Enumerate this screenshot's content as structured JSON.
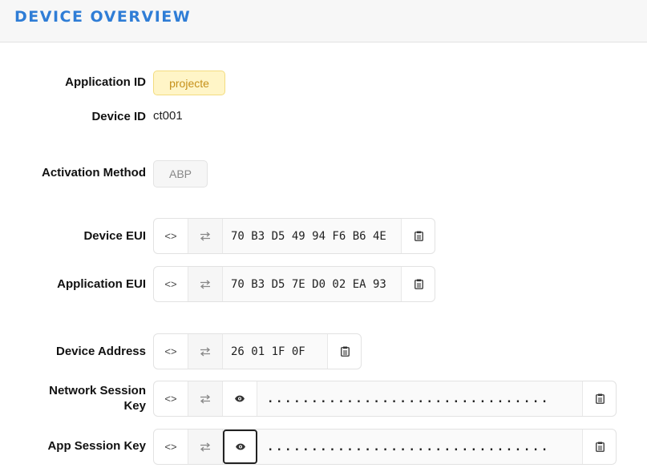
{
  "header": {
    "title": "DEVICE OVERVIEW"
  },
  "labels": {
    "application_id": "Application ID",
    "device_id": "Device ID",
    "activation_method": "Activation Method",
    "device_eui": "Device EUI",
    "application_eui": "Application EUI",
    "device_address": "Device Address",
    "network_session_key_line1": "Network Session",
    "network_session_key_line2": "Key",
    "app_session_key": "App Session Key"
  },
  "values": {
    "application_id": "projecte",
    "device_id": "ct001",
    "activation_method": "ABP",
    "device_eui": "70 B3 D5 49 94 F6 B6 4E",
    "application_eui": "70 B3 D5 7E D0 02 EA 93",
    "device_address": "26 01 1F 0F",
    "network_session_key": "................................",
    "app_session_key": "................................"
  },
  "icons": {
    "code_toggle": "code-icon",
    "byte_order": "swap-icon",
    "reveal": "eye-icon",
    "copy": "clipboard-icon"
  },
  "colors": {
    "title": "#2f7dd6",
    "app_badge_bg": "#fff5c7",
    "app_badge_text": "#c5901a"
  }
}
